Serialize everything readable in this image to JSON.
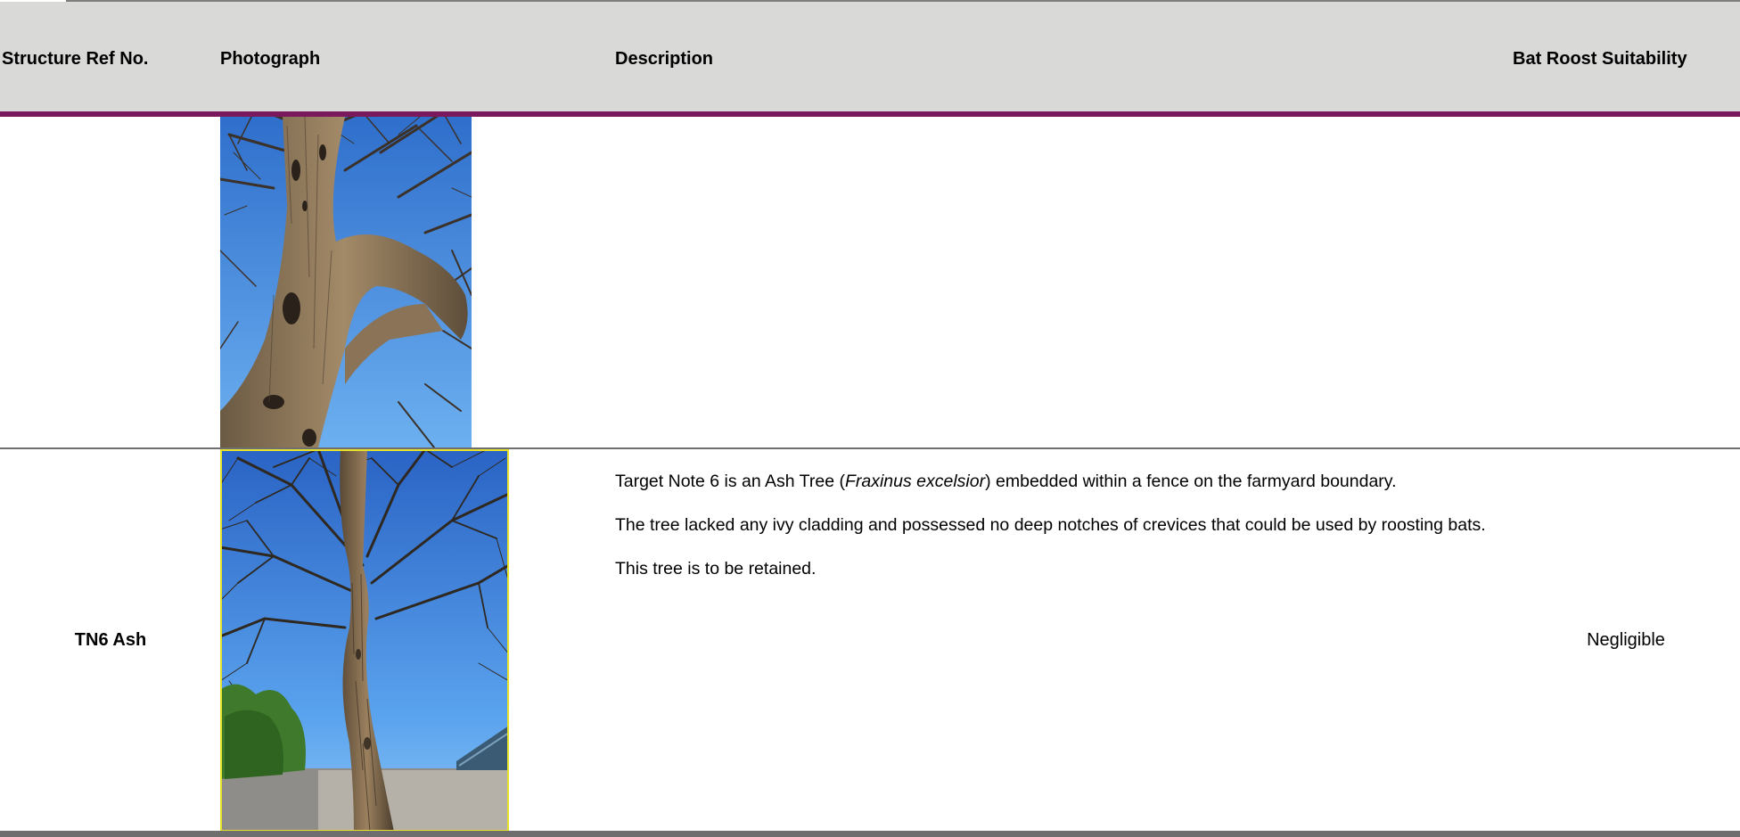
{
  "table": {
    "headers": {
      "ref": "Structure Ref No.",
      "photo": "Photograph",
      "description": "Description",
      "bat": "Bat Roost Suitability"
    },
    "rows": [
      {
        "ref": "",
        "photo": "ash-tree-trunk-branches",
        "description": [],
        "bat": ""
      },
      {
        "ref": "TN6 Ash",
        "photo": "ash-tree-full-view",
        "description": {
          "p1_pre": "Target Note 6 is an Ash Tree (",
          "p1_italic": "Fraxinus excelsior",
          "p1_post": ") embedded within a fence on the farmyard boundary.",
          "p2": "The tree lacked any ivy cladding and possessed no deep notches of crevices that could be used by roosting bats.",
          "p3": "This tree is to be retained."
        },
        "bat": "Negligible"
      }
    ]
  },
  "colors": {
    "header_bg": "#d9d9d8",
    "header_rule": "#7a1a5c",
    "sky": "#4a8fe0",
    "photo_border": "#e6e32a"
  }
}
